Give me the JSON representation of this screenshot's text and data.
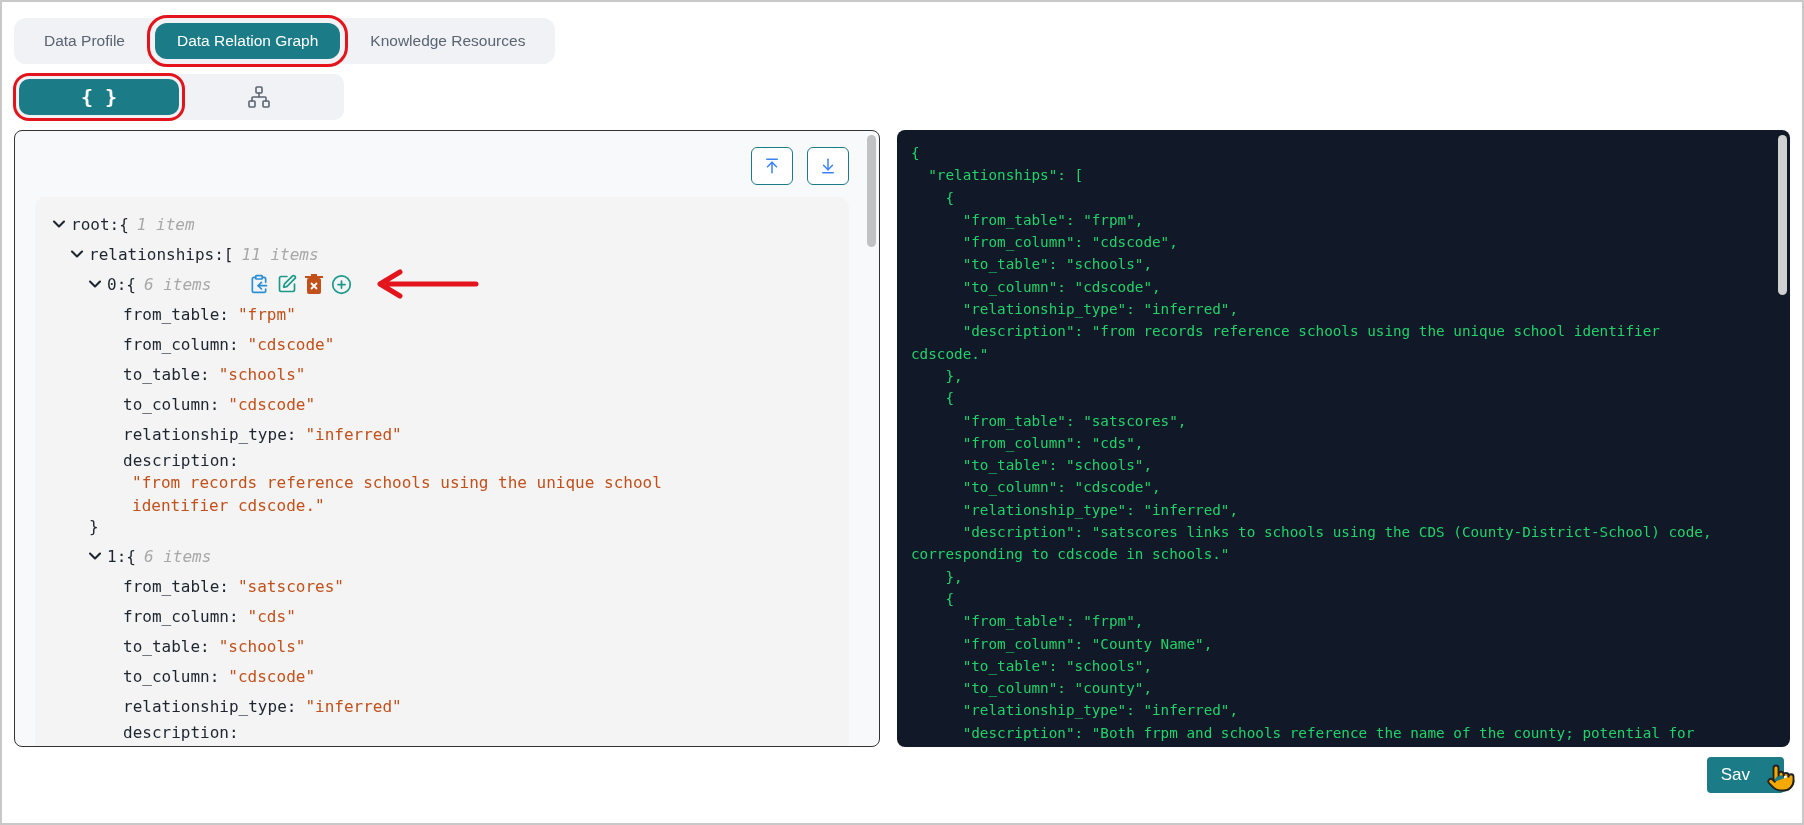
{
  "tabs": [
    {
      "label": "Data Profile",
      "selected": false,
      "highlighted": false
    },
    {
      "label": "Data Relation Graph",
      "selected": true,
      "highlighted": true
    },
    {
      "label": "Knowledge Resources",
      "selected": false,
      "highlighted": false
    }
  ],
  "view_toggle": [
    {
      "kind": "json",
      "label": "{ }",
      "selected": true,
      "highlighted": true
    },
    {
      "kind": "graph",
      "selected": false,
      "highlighted": false
    }
  ],
  "tree": {
    "label": "root:{",
    "count": "1 item",
    "expanded": true,
    "children": [
      {
        "label": "relationships:[",
        "count": "11 items",
        "expanded": true,
        "children": [
          {
            "label": "0:{",
            "count": "6 items",
            "expanded": true,
            "show_actions": true,
            "closing": "}",
            "fields": [
              {
                "kind": "inline",
                "key": "from_table:",
                "value": "\"frpm\""
              },
              {
                "kind": "inline",
                "key": "from_column:",
                "value": "\"cdscode\""
              },
              {
                "kind": "inline",
                "key": "to_table:",
                "value": "\"schools\""
              },
              {
                "kind": "inline",
                "key": "to_column:",
                "value": "\"cdscode\""
              },
              {
                "kind": "inline",
                "key": "relationship_type:",
                "value": "\"inferred\""
              },
              {
                "kind": "block",
                "key": "description:",
                "value": "\"from records reference schools using the unique school identifier cdscode.\""
              }
            ]
          },
          {
            "label": "1:{",
            "count": "6 items",
            "expanded": true,
            "show_actions": false,
            "fields": [
              {
                "kind": "inline",
                "key": "from_table:",
                "value": "\"satscores\""
              },
              {
                "kind": "inline",
                "key": "from_column:",
                "value": "\"cds\""
              },
              {
                "kind": "inline",
                "key": "to_table:",
                "value": "\"schools\""
              },
              {
                "kind": "inline",
                "key": "to_column:",
                "value": "\"cdscode\""
              },
              {
                "kind": "inline",
                "key": "relationship_type:",
                "value": "\"inferred\""
              },
              {
                "kind": "block",
                "key": "description:"
              }
            ]
          }
        ]
      }
    ]
  },
  "code_lines": [
    "{",
    "  \"relationships\": [",
    "    {",
    "      \"from_table\": \"frpm\",",
    "      \"from_column\": \"cdscode\",",
    "      \"to_table\": \"schools\",",
    "      \"to_column\": \"cdscode\",",
    "      \"relationship_type\": \"inferred\",",
    "      \"description\": \"from records reference schools using the unique school identifier",
    "cdscode.\"",
    "    },",
    "    {",
    "      \"from_table\": \"satscores\",",
    "      \"from_column\": \"cds\",",
    "      \"to_table\": \"schools\",",
    "      \"to_column\": \"cdscode\",",
    "      \"relationship_type\": \"inferred\",",
    "      \"description\": \"satscores links to schools using the CDS (County-District-School) code,",
    "corresponding to cdscode in schools.\"",
    "    },",
    "    {",
    "      \"from_table\": \"frpm\",",
    "      \"from_column\": \"County Name\",",
    "      \"to_table\": \"schools\",",
    "      \"to_column\": \"county\",",
    "      \"relationship_type\": \"inferred\",",
    "      \"description\": \"Both frpm and schools reference the name of the county; potential for"
  ],
  "save_button": {
    "label": "Sav"
  }
}
